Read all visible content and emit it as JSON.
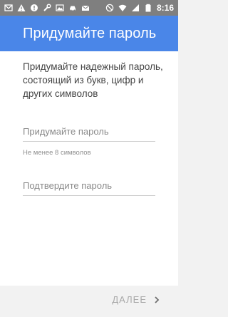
{
  "status_bar": {
    "time": "8:16",
    "left_icons": [
      "gmail-icon",
      "warning-icon",
      "notification-icon",
      "wrench-icon",
      "image-icon",
      "car-icon",
      "mail-icon"
    ],
    "right_icons": [
      "blocked-icon",
      "wifi-icon",
      "signal-icon",
      "battery-icon"
    ]
  },
  "app_bar": {
    "title": "Придумайте пароль",
    "color": "#4a86e8"
  },
  "main": {
    "description": "Придумайте надежный пароль, состоящий из букв, цифр и других символов",
    "password_field": {
      "placeholder": "Придумайте пароль",
      "value": "",
      "hint": "Не менее 8 символов"
    },
    "confirm_field": {
      "placeholder": "Подтвердите пароль",
      "value": ""
    }
  },
  "footer": {
    "next_label": "ДАЛЕЕ",
    "next_icon": "chevron-right-icon"
  }
}
